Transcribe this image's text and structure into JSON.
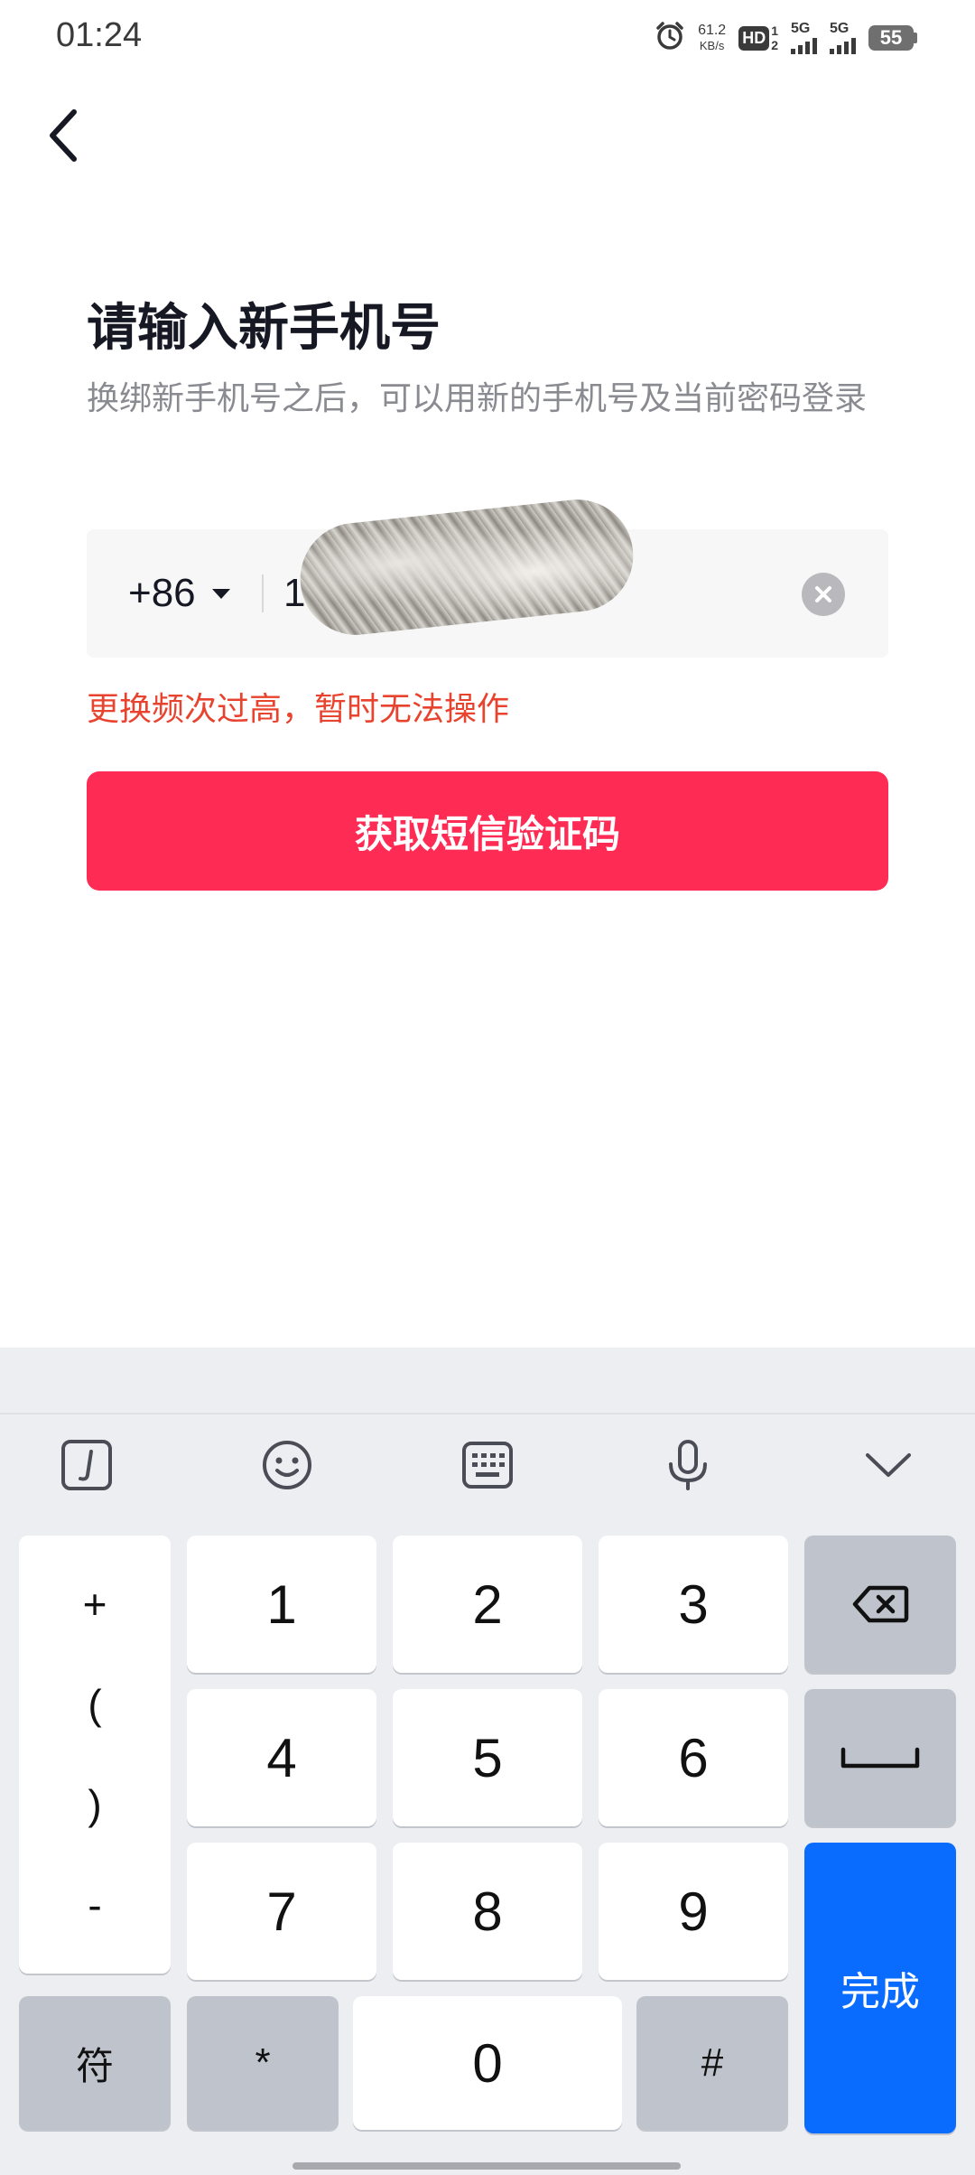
{
  "status_bar": {
    "time": "01:24",
    "net_speed_value": "61.2",
    "net_speed_unit": "KB/s",
    "hd_label": "HD",
    "hd_sim_top": "1",
    "hd_sim_bottom": "2",
    "sim1_network": "5G",
    "sim2_network": "5G",
    "battery_level": "55",
    "icons": [
      "alarm-icon",
      "hd-voice-icon",
      "signal-icon",
      "battery-icon"
    ]
  },
  "header": {
    "back_icon": "chevron-left-icon"
  },
  "main": {
    "title": "请输入新手机号",
    "subtitle": "换绑新手机号之后，可以用新的手机号及当前密码登录",
    "country_code": "+86",
    "phone_value": "1",
    "phone_redacted": true,
    "error_text": "更换频次过高，暂时无法操作",
    "submit_label": "获取短信验证码"
  },
  "keyboard": {
    "toolbar_icons": [
      "handwriting-icon",
      "emoji-icon",
      "keyboard-icon",
      "microphone-icon",
      "chevron-down-icon"
    ],
    "symbols": [
      "+",
      "(",
      ")",
      "-"
    ],
    "digits": [
      "1",
      "2",
      "3",
      "4",
      "5",
      "6",
      "7",
      "8",
      "9"
    ],
    "symbol_switch": "符",
    "star": "*",
    "zero": "0",
    "hash": "#",
    "done_label": "完成",
    "backspace_icon": "backspace-icon",
    "space_icon": "space-icon"
  },
  "colors": {
    "primary_button": "#fe2c55",
    "error_text": "#e8432e",
    "done_key": "#0a6cff"
  }
}
